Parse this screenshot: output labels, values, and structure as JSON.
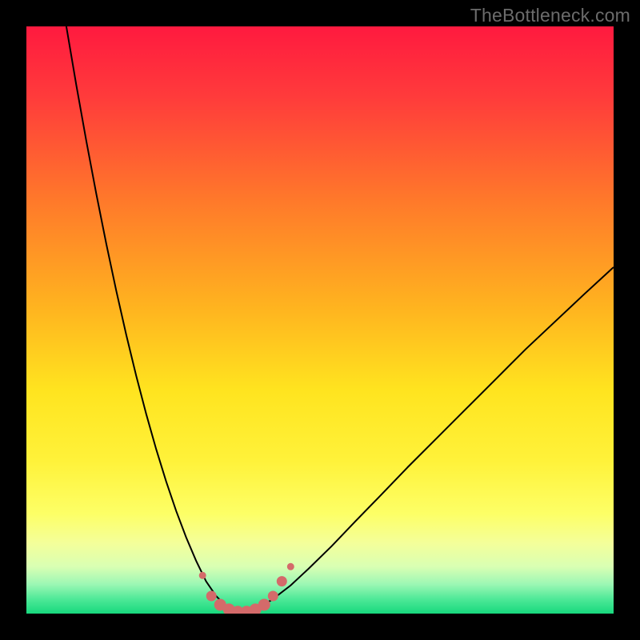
{
  "watermark": "TheBottleneck.com",
  "colors": {
    "frame": "#000000",
    "curve_stroke": "#000000",
    "marker_fill": "#d46a6a",
    "marker_stroke": "#d46a6a"
  },
  "chart_data": {
    "type": "line",
    "title": "",
    "xlabel": "",
    "ylabel": "",
    "xlim": [
      0,
      100
    ],
    "ylim": [
      0,
      100
    ],
    "background_gradient_stops": [
      {
        "offset": 0.0,
        "color": "#ff1a3f"
      },
      {
        "offset": 0.12,
        "color": "#ff3b3b"
      },
      {
        "offset": 0.3,
        "color": "#ff7a2a"
      },
      {
        "offset": 0.48,
        "color": "#ffb41f"
      },
      {
        "offset": 0.62,
        "color": "#ffe41f"
      },
      {
        "offset": 0.74,
        "color": "#fff23a"
      },
      {
        "offset": 0.83,
        "color": "#fdff66"
      },
      {
        "offset": 0.88,
        "color": "#f4ff9a"
      },
      {
        "offset": 0.92,
        "color": "#d9ffb3"
      },
      {
        "offset": 0.95,
        "color": "#9cf7b4"
      },
      {
        "offset": 0.975,
        "color": "#4fe998"
      },
      {
        "offset": 1.0,
        "color": "#17d87d"
      }
    ],
    "series": [
      {
        "name": "left_arm",
        "x": [
          6.8,
          8.5,
          10.2,
          11.9,
          13.6,
          15.3,
          17.0,
          18.7,
          20.4,
          22.1,
          23.8,
          25.5,
          27.2,
          28.9,
          30.6,
          32.3,
          34.0,
          35.7,
          36.5
        ],
        "y": [
          100.0,
          90.0,
          80.5,
          71.5,
          63.0,
          55.0,
          47.5,
          40.5,
          34.0,
          28.0,
          22.5,
          17.5,
          13.0,
          9.0,
          5.5,
          3.0,
          1.3,
          0.3,
          0.0
        ]
      },
      {
        "name": "right_arm",
        "x": [
          36.5,
          38.0,
          40.0,
          42.0,
          45.0,
          48.0,
          52.0,
          56.0,
          60.0,
          65.0,
          70.0,
          75.0,
          80.0,
          85.0,
          90.0,
          95.0,
          100.0
        ],
        "y": [
          0.0,
          0.3,
          1.2,
          2.5,
          4.8,
          7.6,
          11.5,
          15.7,
          19.8,
          25.0,
          30.0,
          35.0,
          40.0,
          45.0,
          49.7,
          54.4,
          59.0
        ]
      }
    ],
    "markers": {
      "name": "bottom_cluster",
      "points": [
        {
          "x": 30.0,
          "y": 6.5,
          "r": 4
        },
        {
          "x": 31.5,
          "y": 3.0,
          "r": 6
        },
        {
          "x": 33.0,
          "y": 1.5,
          "r": 7
        },
        {
          "x": 34.5,
          "y": 0.7,
          "r": 7
        },
        {
          "x": 36.0,
          "y": 0.3,
          "r": 7
        },
        {
          "x": 37.5,
          "y": 0.3,
          "r": 7
        },
        {
          "x": 39.0,
          "y": 0.7,
          "r": 7
        },
        {
          "x": 40.5,
          "y": 1.5,
          "r": 7
        },
        {
          "x": 42.0,
          "y": 3.0,
          "r": 6
        },
        {
          "x": 43.5,
          "y": 5.5,
          "r": 6
        },
        {
          "x": 45.0,
          "y": 8.0,
          "r": 4
        }
      ]
    }
  }
}
